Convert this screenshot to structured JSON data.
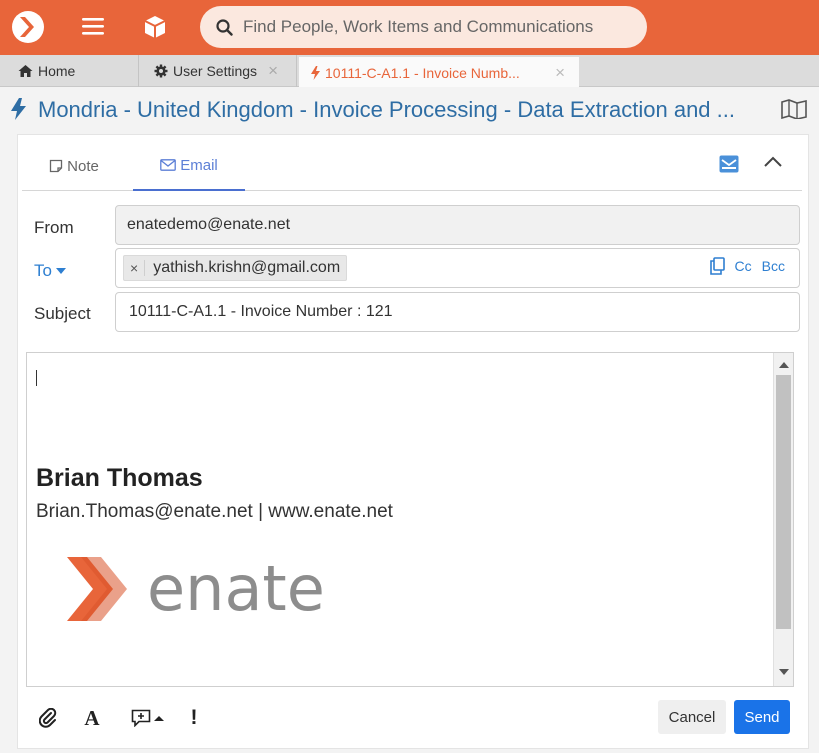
{
  "colors": {
    "brand_orange": "#e8653a",
    "search_bg": "#fbe8df",
    "title_blue": "#2e6da4",
    "link_blue": "#2e7fd1",
    "send_blue": "#1a73e8",
    "tab_active_accent": "#4a6fd0"
  },
  "topbar": {
    "logo_icon": "enate-logo-icon",
    "menu_icon": "hamburger-icon",
    "box_icon": "box-icon",
    "search": {
      "placeholder": "Find People, Work Items and Communications",
      "icon": "search-icon"
    }
  },
  "tabs": [
    {
      "label": "Home",
      "icon": "home-icon",
      "closable": false
    },
    {
      "label": "User Settings",
      "icon": "gear-icon",
      "closable": true
    },
    {
      "label": "10111-C-A1.1 - Invoice Numb...",
      "icon": "bolt-icon",
      "closable": true,
      "active": true
    }
  ],
  "header": {
    "title": "Mondria - United Kingdom - Invoice Processing - Data Extraction and ...",
    "icon": "bolt-icon",
    "right_icon": "book-icon"
  },
  "panel": {
    "tabs": [
      {
        "label": "Note",
        "icon": "note-icon"
      },
      {
        "label": "Email",
        "icon": "envelope-icon",
        "active": true
      }
    ]
  },
  "form": {
    "from_label": "From",
    "from_value": "enatedemo@enate.net",
    "to_label": "To",
    "to_recipient": "yathish.krishn@gmail.com",
    "chip_remove": "×",
    "cc_label": "Cc",
    "bcc_label": "Bcc",
    "subject_label": "Subject",
    "subject_value": "10111-C-A1.1 - Invoice Number : 121"
  },
  "signature": {
    "name": "Brian Thomas",
    "contact": "Brian.Thomas@enate.net | www.enate.net",
    "logo_text": "enate"
  },
  "toolbar": {
    "font_label": "A",
    "important_label": "!",
    "cancel_label": "Cancel",
    "send_label": "Send"
  }
}
